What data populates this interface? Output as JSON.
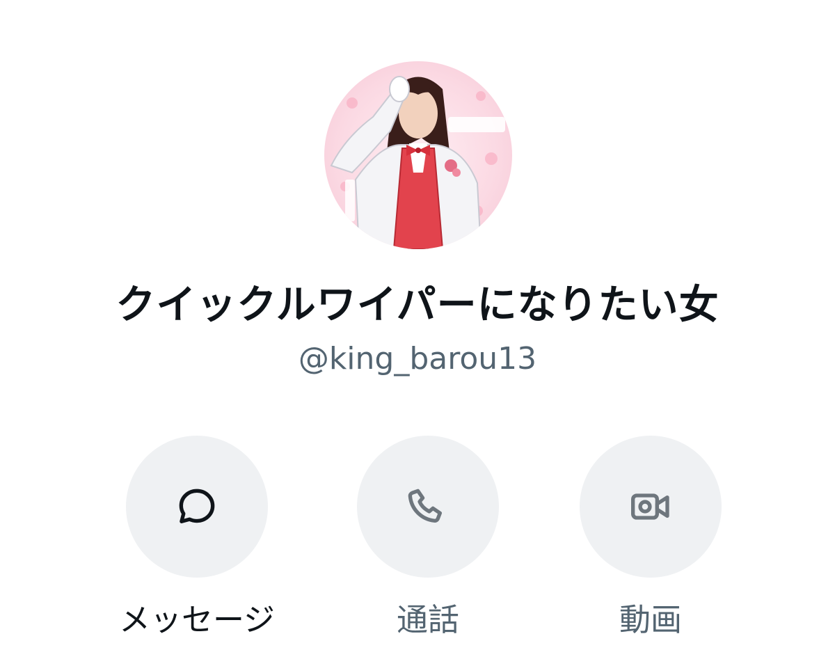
{
  "profile": {
    "display_name": "クイックルワイパーになりたい女",
    "handle": "@king_barou13",
    "avatar_icon": "anime-character-avatar"
  },
  "actions": [
    {
      "label": "メッセージ",
      "icon": "message-bubble-icon",
      "color": "#0f1419",
      "enabled": true
    },
    {
      "label": "通話",
      "icon": "phone-icon",
      "color": "#6e767d",
      "enabled": false
    },
    {
      "label": "動画",
      "icon": "video-camera-icon",
      "color": "#6e767d",
      "enabled": false
    }
  ],
  "colors": {
    "text_primary": "#0f1419",
    "text_secondary": "#536471",
    "button_bg": "#eff1f3",
    "background": "#ffffff"
  }
}
